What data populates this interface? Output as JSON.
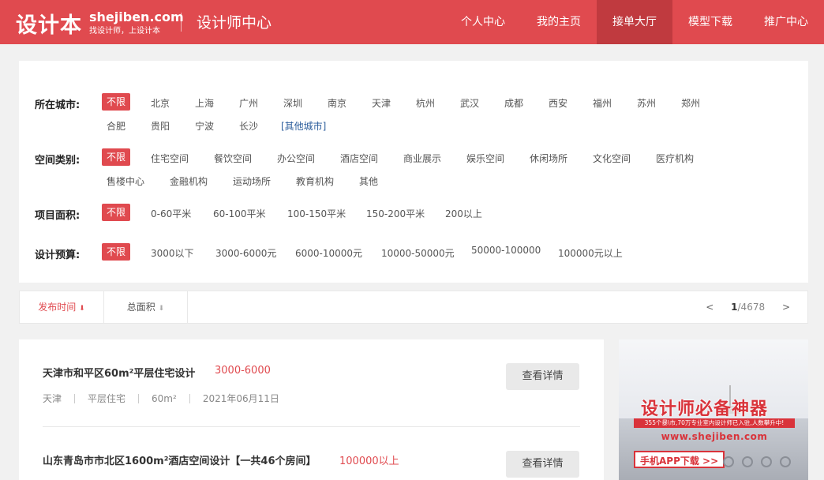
{
  "header": {
    "logo_text": "设计本",
    "logo_domain": "shejiben.com",
    "logo_slogan": "找设计师，上设计本",
    "center_title": "设计师中心",
    "nav": [
      {
        "label": "个人中心"
      },
      {
        "label": "我的主页"
      },
      {
        "label": "接单大厅",
        "active": true
      },
      {
        "label": "模型下载"
      },
      {
        "label": "推广中心"
      }
    ],
    "colors": {
      "brand": "#e04a4f",
      "active": "#c03a3f"
    }
  },
  "filters": {
    "city": {
      "label": "所在城市:",
      "row1": [
        "不限",
        "北京",
        "上海",
        "广州",
        "深圳",
        "南京",
        "天津",
        "杭州",
        "武汉",
        "成都",
        "西安",
        "福州",
        "苏州",
        "郑州"
      ],
      "row2": [
        "合肥",
        "贵阳",
        "宁波",
        "长沙",
        "[其他城市]"
      ]
    },
    "space": {
      "label": "空间类别:",
      "row1": [
        "不限",
        "住宅空间",
        "餐饮空间",
        "办公空间",
        "酒店空间",
        "商业展示",
        "娱乐空间",
        "休闲场所",
        "文化空间",
        "医疗机构"
      ],
      "row2": [
        "售楼中心",
        "金融机构",
        "运动场所",
        "教育机构",
        "其他"
      ]
    },
    "area": {
      "label": "项目面积:",
      "options": [
        "不限",
        "0-60平米",
        "60-100平米",
        "100-150平米",
        "150-200平米",
        "200以上"
      ]
    },
    "budget": {
      "label": "设计预算:",
      "options": [
        "不限",
        "3000以下",
        "3000-6000元",
        "6000-10000元",
        "10000-50000元",
        "50000-100000",
        "100000元以上"
      ]
    }
  },
  "sort": {
    "publish_time": "发布时间",
    "total_area": "总面积",
    "arrow": "⬇",
    "pager": {
      "prev": "<",
      "current": "1",
      "total": "/4678",
      "next": ">"
    }
  },
  "projects": [
    {
      "title": "天津市和平区60m²平层住宅设计",
      "budget": "3000-6000",
      "meta": [
        "天津",
        "平层住宅",
        "60m²",
        "2021年06月11日"
      ],
      "button": "查看详情"
    },
    {
      "title": "山东青岛市市北区1600m²酒店空间设计【一共46个房间】",
      "budget": "100000以上",
      "button": "查看详情"
    }
  ],
  "ad": {
    "title": "设计师必备神器",
    "subtitle": "355个暴\\市,70万专业室内设计师已入驻,人数攀升中!",
    "url": "www.shejiben.com",
    "cta": "手机APP下载 >>"
  }
}
